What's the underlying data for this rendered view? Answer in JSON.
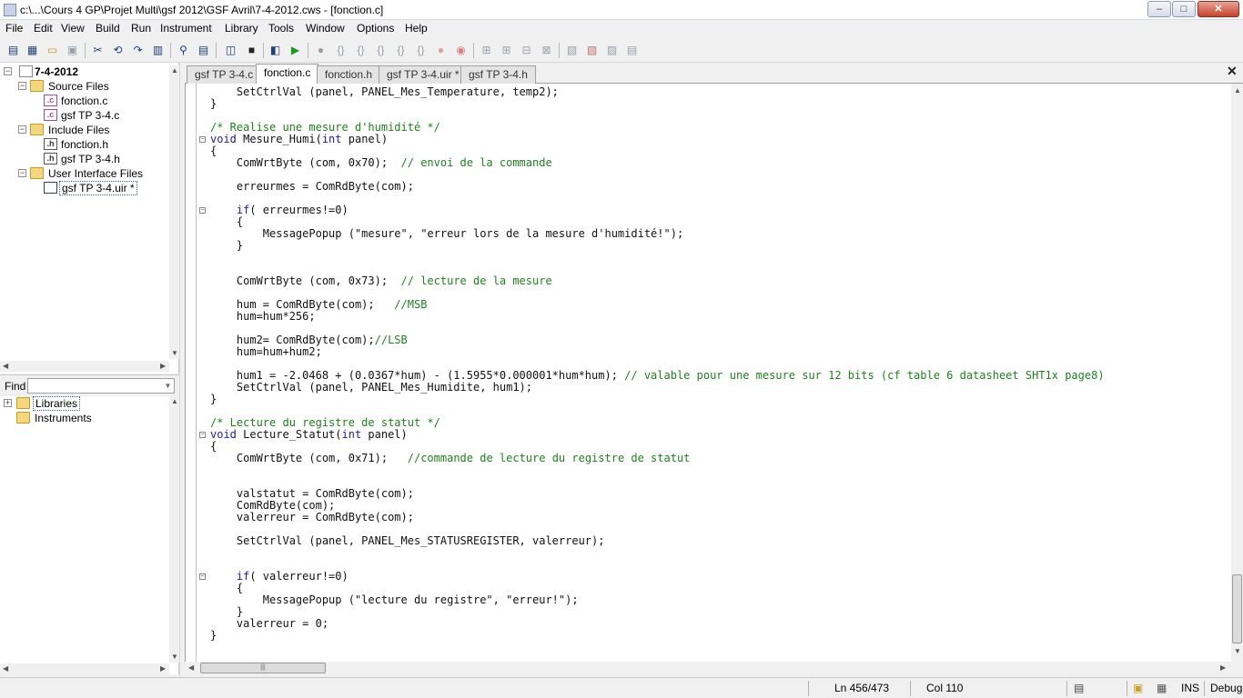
{
  "window": {
    "title": "c:\\...\\Cours 4 GP\\Projet Multi\\gsf 2012\\GSF Avril\\7-4-2012.cws - [fonction.c]",
    "minimize": "–",
    "maximize": "□",
    "close": "✕"
  },
  "menus": [
    "File",
    "Edit",
    "View",
    "Build",
    "Run",
    "Instrument",
    "Library",
    "Tools",
    "Window",
    "Options",
    "Help"
  ],
  "toolbar": {
    "icons": [
      "new-icon",
      "open-uir-icon",
      "open-icon",
      "save-icon",
      "cut-icon",
      "recall-panel-icon",
      "find-icon",
      "build-icon",
      "debug-icon",
      "stop-icon",
      "run-icon",
      "go-icon",
      "step-into-icon",
      "step-over-icon",
      "step-out-icon",
      "run-to-cursor-icon",
      "stop-debug-icon",
      "breakpoint-icon",
      "watch-icon",
      "variables-icon",
      "memory-icon",
      "stack-icon",
      "callers-icon",
      "compare-icon",
      "diff-icon",
      "format-icon"
    ]
  },
  "project_tree": {
    "workspace": "7-4-2012",
    "folders": [
      {
        "label": "Source Files",
        "files": [
          "fonction.c",
          "gsf TP 3-4.c"
        ]
      },
      {
        "label": "Include Files",
        "files": [
          "fonction.h",
          "gsf TP 3-4.h"
        ]
      },
      {
        "label": "User Interface Files",
        "files": [
          "gsf TP 3-4.uir *"
        ]
      }
    ]
  },
  "find": {
    "label": "Find",
    "value": ""
  },
  "library_tree": {
    "items": [
      "Libraries",
      "Instruments"
    ]
  },
  "tabs": [
    "gsf TP 3-4.c",
    "fonction.c",
    "fonction.h",
    "gsf TP 3-4.uir *",
    "gsf TP 3-4.h"
  ],
  "active_tab": "fonction.c",
  "tab_close": "✕",
  "code_lines": [
    "    SetCtrlVal (panel, PANEL_Mes_Temperature, temp2);",
    "}",
    "",
    "/* Realise une mesure d'humidité */",
    "void Mesure_Humi(int panel)",
    "{",
    "    ComWrtByte (com, 0x70);  // envoi de la commande",
    "",
    "    erreurmes = ComRdByte(com);",
    "",
    "    if( erreurmes!=0)",
    "    {",
    "        MessagePopup (\"mesure\", \"erreur lors de la mesure d'humidité!\");",
    "    }",
    "",
    "",
    "    ComWrtByte (com, 0x73);  // lecture de la mesure",
    "",
    "    hum = ComRdByte(com);   //MSB",
    "    hum=hum*256;",
    "",
    "    hum2= ComRdByte(com);//LSB",
    "    hum=hum+hum2;",
    "",
    "    hum1 = -2.0468 + (0.0367*hum) - (1.5955*0.000001*hum*hum); // valable pour une mesure sur 12 bits (cf table 6 datasheet SHT1x page8)",
    "    SetCtrlVal (panel, PANEL_Mes_Humidite, hum1);",
    "}",
    "",
    "/* Lecture du registre de statut */",
    "void Lecture_Statut(int panel)",
    "{",
    "    ComWrtByte (com, 0x71);   //commande de lecture du registre de statut",
    "",
    "",
    "    valstatut = ComRdByte(com);",
    "    ComRdByte(com);",
    "    valerreur = ComRdByte(com);",
    "",
    "    SetCtrlVal (panel, PANEL_Mes_STATUSREGISTER, valerreur);",
    "",
    "",
    "    if( valerreur!=0)",
    "    {",
    "        MessagePopup (\"lecture du registre\", \"erreur!\");",
    "    }",
    "    valerreur = 0;",
    "}"
  ],
  "status": {
    "position": "Ln 456/473",
    "column": "Col 110",
    "mode": "INS",
    "config": "Debug"
  },
  "colors": {
    "keyword": "#1c1ca5",
    "comment": "#208020",
    "editor_bg": "#ffffff"
  }
}
